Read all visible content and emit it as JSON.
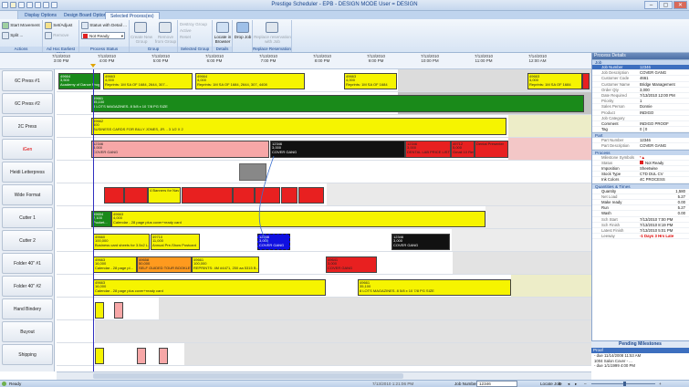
{
  "window": {
    "title": "Prestige Scheduler - EPB - DESIGN MODE User = DESIGN",
    "min": "–",
    "max": "▢",
    "close": "✕"
  },
  "tabs": [
    "Display Options",
    "Design Board Options",
    "Selected Process(es)"
  ],
  "ribbon": {
    "actions": {
      "label": "Actions",
      "items": [
        "Start Movement",
        "Split ..."
      ]
    },
    "earliest": {
      "label": "Ad Hoc Earliest Start",
      "items": [
        "Set/Adjust",
        "Remove"
      ]
    },
    "status": {
      "label": "Process Status",
      "items": [
        "Status with Detail ...",
        "Not Ready"
      ]
    },
    "group": {
      "label": "Group",
      "items": [
        "Create New Group",
        "Remove from Group"
      ]
    },
    "selgroup": {
      "label": "Selected Group",
      "items": [
        "Destroy Group",
        "Active",
        "Reset"
      ]
    },
    "details": {
      "label": "Details",
      "items": [
        "Locate in Browser"
      ]
    },
    "dropjob": {
      "label": "",
      "items": [
        "Drop Job"
      ]
    },
    "replace": {
      "label": "Replace Reservation",
      "items": [
        "Replace reservation with Job"
      ]
    }
  },
  "timeline": {
    "ticks": [
      {
        "date": "7/13/2010",
        "time": "3:00 PM"
      },
      {
        "date": "7/13/2010",
        "time": "4:00 PM"
      },
      {
        "date": "7/13/2010",
        "time": "5:00 PM"
      },
      {
        "date": "7/13/2010",
        "time": "6:00 PM"
      },
      {
        "date": "7/13/2010",
        "time": "7:00 PM"
      },
      {
        "date": "7/13/2010",
        "time": "8:00 PM"
      },
      {
        "date": "7/13/2010",
        "time": "9:00 PM"
      },
      {
        "date": "7/13/2010",
        "time": "10:00 PM"
      },
      {
        "date": "7/13/2010",
        "time": "11:00 PM"
      },
      {
        "date": "7/14/2010",
        "time": "12:00 AM"
      }
    ]
  },
  "resources": [
    "6C Press #1",
    "6C Press #2",
    "2C Press",
    "iGen",
    "Heidi Letterpress",
    "Wide Format",
    "Cutter 1",
    "Cutter 2",
    "Folder 40\" #1",
    "Folder 40\" #2",
    "Hand Bindery",
    "Buyout",
    "Shipping"
  ],
  "bars": {
    "b1": {
      "id": "49664",
      "qty": "3,500",
      "text": "Academy of Dance Prog"
    },
    "b2": {
      "id": "49663",
      "qty": "4,000",
      "text": "Reprints: 1M SA OF 1684, 2644, 307..."
    },
    "b3": {
      "id": "49664",
      "qty": "4,000",
      "text": "Reprints: 1M SA OF 1684, 2644, 307, 4408"
    },
    "b4": {
      "id": "49663",
      "qty": "4,000",
      "text": "Reprints: 1M SA OF 1684"
    },
    "b5": {
      "id": "49661",
      "qty": "35,100",
      "text": "8 LOTS MAGAZINES. 8 5/8 x 10 7/8 PG SIZE"
    },
    "b6": {
      "id": "49662",
      "qty": "500",
      "text": "BUSINESS CARDS FOR BILLY JONES, JR. - 3 1/2 X 2"
    },
    "b7": {
      "id": "12346",
      "qty": "3,000",
      "text": "COVER GANG"
    },
    "b8": {
      "id": "12346",
      "qty": "3,000",
      "text": "COVER GANG"
    },
    "b9": {
      "id": "12346",
      "qty": "3,000",
      "text": "DENTAL LAB PRICE LIST ..."
    },
    "b10": {
      "id": "49712",
      "qty": "5,000",
      "text": "Gmail 10 Rev"
    },
    "b11": {
      "id": "",
      "qty": "",
      "text": "Dental Presenter"
    },
    "b12": {
      "id": "",
      "qty": "",
      "text": "4 Banners for Nav"
    },
    "b13": {
      "id": "49654",
      "qty": "7,100",
      "text": "Pocket..."
    },
    "b14": {
      "id": "49663",
      "qty": "4,000",
      "text": "Calendar - 28 page plus cover+ready card"
    },
    "b15": {
      "id": "49660",
      "qty": "100,000",
      "text": "Business card sheets for 3.5x2 L..."
    },
    "b16": {
      "id": "49710",
      "qty": "11,000",
      "text": "Annual Pre-Show Postcard"
    },
    "b17": {
      "id": "12346",
      "qty": "3,000",
      "text": "COVER GANG"
    },
    "b18": {
      "id": "12346",
      "qty": "3,000",
      "text": "COVER GANG"
    },
    "b19": {
      "id": "49663",
      "qty": "16,000",
      "text": "Calendar - 28 page pl..."
    },
    "b20": {
      "id": "49658",
      "qty": "50,000",
      "text": "SELF GUIDED TOUR BOOKLET-C..."
    },
    "b21": {
      "id": "49661",
      "qty": "100,000",
      "text": "REPRINTS: 4M #4471, 250 aa 5315 B..."
    },
    "b22": {
      "id": "49641",
      "qty": "3,000",
      "text": "COVER GANG"
    },
    "b23": {
      "id": "49663",
      "qty": "16,000",
      "text": "Calendar - 28 page plus cover+ready card"
    },
    "b24": {
      "id": "49661",
      "qty": "35,100",
      "text": "8 LOTS MAGAZINES. 8 5/8 x 10 7/8 PG SIZE"
    }
  },
  "panel": {
    "title": "Process Details",
    "sections": {
      "job": {
        "label": "Job",
        "rows": [
          {
            "k": "Job Number",
            "v": "12346",
            "sel": true
          },
          {
            "k": "Job Description",
            "v": "COVER GANG"
          },
          {
            "k": "Customer Code",
            "v": "4661"
          },
          {
            "k": "Customer Name",
            "v": "Bridge Management"
          },
          {
            "k": "Order Qty",
            "v": "3,000"
          },
          {
            "k": "Date Required",
            "v": "7/13/2010 12:00 PM"
          },
          {
            "k": "Priority",
            "v": "1"
          },
          {
            "k": "Sales Person",
            "v": "Donnie"
          },
          {
            "k": "Product",
            "v": "INDIGO"
          },
          {
            "k": "Job Category",
            "v": ""
          },
          {
            "k": "Comment",
            "v": "INDIGO PROOF"
          },
          {
            "k": "Tag",
            "v": "0 | 0"
          }
        ]
      },
      "part": {
        "label": "Part",
        "rows": [
          {
            "k": "Part Number",
            "v": "12346"
          },
          {
            "k": "Part Description",
            "v": "COVER GANG"
          }
        ]
      },
      "process": {
        "label": "Process",
        "rows": [
          {
            "k": "Milestone Symbols",
            "v": "*▲"
          },
          {
            "k": "Status",
            "v": "Not Ready"
          },
          {
            "k": "Imposition",
            "v": "Sheetwise"
          },
          {
            "k": "Stock Type",
            "v": "CTD DUL CV"
          },
          {
            "k": "Ink Colors",
            "v": "4C PROCESS"
          }
        ]
      },
      "qty": {
        "label": "Quantities & Times",
        "rows": [
          {
            "k": "Quantity",
            "v": "1,580",
            "num": true
          },
          {
            "k": "Net Load",
            "v": "5.27",
            "num": true
          },
          {
            "k": "Make ready",
            "v": "0.00",
            "num": true
          },
          {
            "k": "Run",
            "v": "5.27",
            "num": true
          },
          {
            "k": "Wash",
            "v": "0.00",
            "num": true
          },
          {
            "k": "Sch Start",
            "v": "7/13/2010 7:00 PM"
          },
          {
            "k": "Sch Finish",
            "v": "7/13/2010 8:19 PM"
          },
          {
            "k": "Latest Finish",
            "v": "7/13/2010 5:01 PM"
          },
          {
            "k": "Leeway",
            "v": "-1 Days 3 Hrs Late"
          }
        ]
      }
    },
    "milestones": {
      "title": "Pending Milestones",
      "selected": "Proof",
      "lines": [
        "- due 11/14/2008 11:53 AM",
        "1004 Salon Cover - ...",
        "- due 1/1/1999 4:00 PM"
      ]
    }
  },
  "statusbar": {
    "ready": "Ready",
    "datetime": "7/13/2010 1:21:06 PM",
    "job_label": "Job Number",
    "job_value": "12346",
    "locate_label": "Locate Job"
  },
  "colors": {
    "yellow": "#f6f400",
    "green": "#1a8a1a",
    "red": "#e82020",
    "black": "#111111",
    "blue": "#1010e0",
    "orange": "#ff9a1e",
    "pink": "#f7a7a7",
    "accent": "#15428b"
  }
}
